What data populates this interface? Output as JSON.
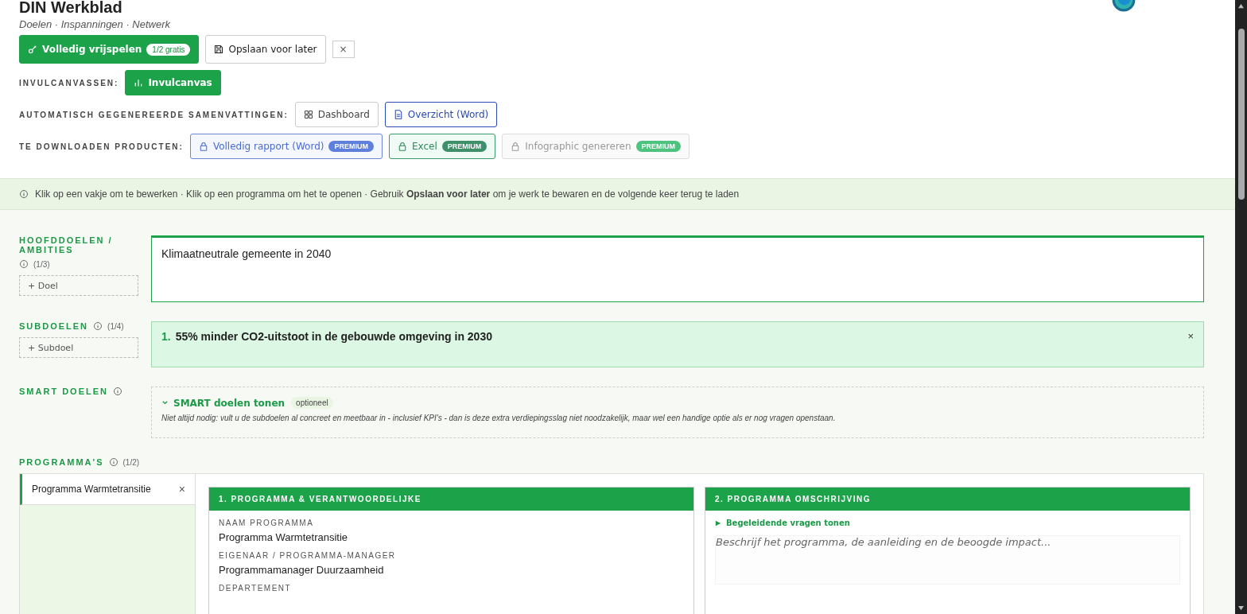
{
  "header": {
    "title": "DIN Werkblad",
    "subtitle": "Doelen · Inspanningen · Netwerk"
  },
  "actions": {
    "unlock": {
      "label": "Volledig vrijspelen",
      "badge": "1/2 gratis"
    },
    "save": {
      "label": "Opslaan voor later"
    },
    "close": "×"
  },
  "canvases": {
    "label": "INVULCANVASSEN:",
    "items": [
      {
        "label": "Invulcanvas"
      }
    ]
  },
  "summaries": {
    "label": "AUTOMATISCH GEGENEREERDE SAMENVATTINGEN:",
    "items": [
      {
        "label": "Dashboard",
        "kind": "dashboard",
        "selected": false
      },
      {
        "label": "Overzicht (Word)",
        "kind": "document",
        "selected": true
      }
    ]
  },
  "downloads": {
    "label": "TE DOWNLOADEN PRODUCTEN:",
    "items": [
      {
        "label": "Volledig rapport (Word)",
        "badge": "PREMIUM",
        "kind": "word"
      },
      {
        "label": "Excel",
        "badge": "PREMIUM",
        "kind": "excel"
      },
      {
        "label": "Infographic genereren",
        "badge": "PREMIUM",
        "kind": "infographic"
      }
    ]
  },
  "info_bar": "Klik op een vakje om te bewerken · Klik op een programma om het te openen · Gebruik **Opslaan voor later** om je werk te bewaren en de volgende keer terug te laden",
  "main_goals": {
    "label": "HOOFDDOELEN / AMBITIES",
    "count": "(1/3)",
    "add": "+ Doel",
    "items": [
      {
        "text": "Klimaatneutrale gemeente in 2040"
      }
    ]
  },
  "sub_goals": {
    "label": "SUBDOELEN",
    "count": "(1/4)",
    "add": "+ Subdoel",
    "items": [
      {
        "number": "1.",
        "text": "55% minder CO2-uitstoot in de gebouwde omgeving in 2030",
        "close": "×"
      }
    ]
  },
  "smart_goals": {
    "label": "SMART DOELEN",
    "toggle": "SMART doelen tonen",
    "badge": "optioneel",
    "note": "Niet altijd nodig: vult u de subdoelen al concreet en meetbaar in - inclusief KPI's - dan is deze extra verdiepingsslag niet noodzakelijk, maar wel een handige optie als er nog vragen openstaan."
  },
  "programs": {
    "label": "PROGRAMMA'S",
    "count": "(1/2)",
    "tabs": [
      {
        "label": "Programma Warmtetransitie",
        "close": "×",
        "selected": true
      }
    ],
    "cards": [
      {
        "kind": "fields",
        "title": "1. PROGRAMMA & VERANTWOORDELIJKE",
        "fields": [
          {
            "label": "NAAM PROGRAMMA",
            "value": "Programma Warmtetransitie"
          },
          {
            "label": "EIGENAAR / PROGRAMMA-MANAGER",
            "value": "Programmamanager Duurzaamheid"
          },
          {
            "label": "DEPARTEMENT"
          }
        ]
      },
      {
        "kind": "text",
        "title": "2. PROGRAMMA OMSCHRIJVING",
        "toggle": "Begeleidende vragen tonen",
        "placeholder": "Beschrijf het programma, de aanleiding en de beoogde impact..."
      }
    ]
  }
}
